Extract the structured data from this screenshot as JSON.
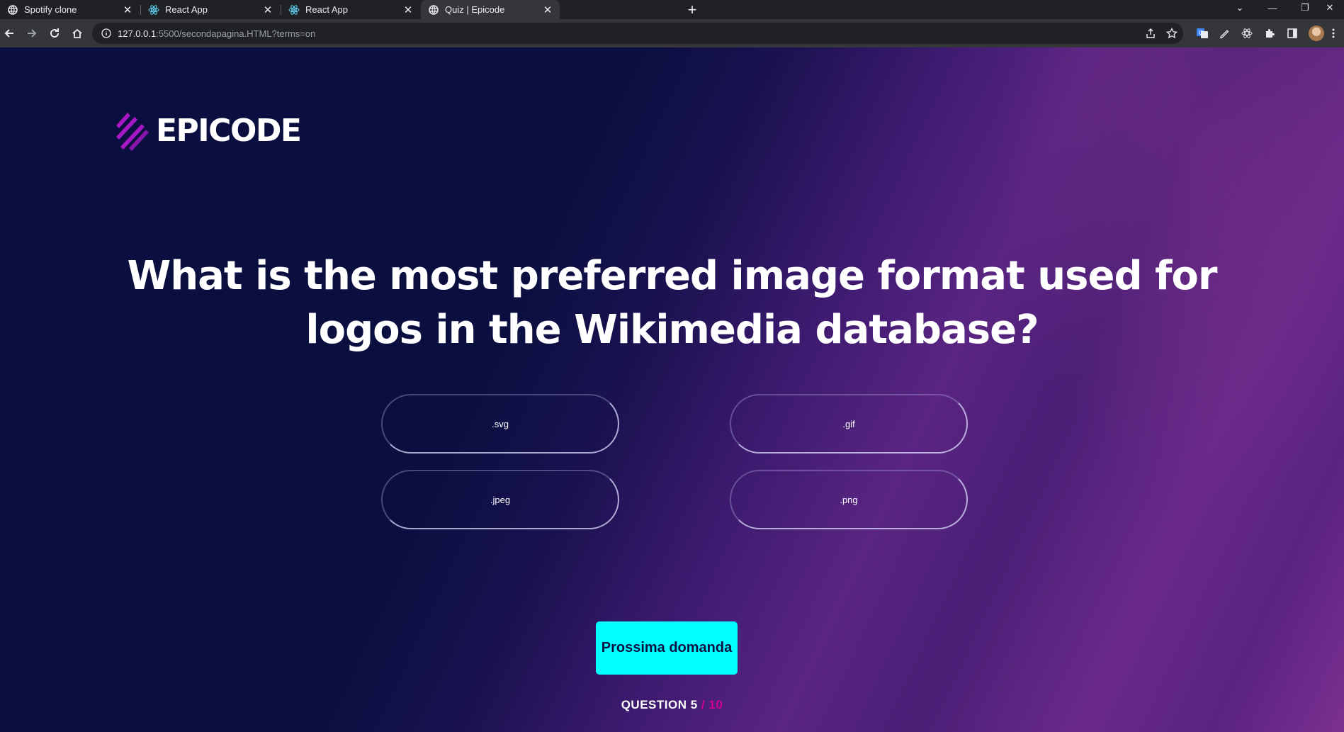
{
  "browser": {
    "tabs": [
      {
        "title": "Spotify clone",
        "icon": "globe-icon",
        "active": false
      },
      {
        "title": "React App",
        "icon": "react-icon",
        "active": false
      },
      {
        "title": "React App",
        "icon": "react-icon",
        "active": false
      },
      {
        "title": "Quiz | Epicode",
        "icon": "globe-icon",
        "active": true
      }
    ],
    "url_host": "127.0.0.1",
    "url_rest": ":5500/secondapagina.HTML?terms=on"
  },
  "brand": {
    "logo_text": "EPICODE",
    "accent": "#d20094",
    "mark_colors": [
      "#d20094",
      "#7b2ff7"
    ]
  },
  "quiz": {
    "question": "What is the most preferred image format used for logos in the Wikimedia database?",
    "answers": [
      ".svg",
      ".gif",
      ".jpeg",
      ".png"
    ],
    "next_label": "Prossima domanda",
    "counter_label": "QUESTION",
    "current": "5",
    "separator": "/",
    "total": "10",
    "button_color": "#00ffff"
  }
}
